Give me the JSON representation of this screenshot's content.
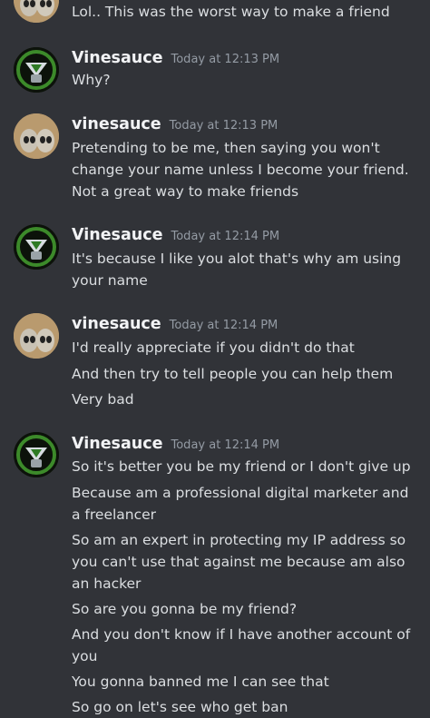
{
  "messages": [
    {
      "user": "",
      "time": "",
      "avatar": "alien-avatar",
      "lines": [
        "Lol.. This was the worst way to make a friend"
      ]
    },
    {
      "user": "Vinesauce",
      "time": "Today at 12:13 PM",
      "avatar": "vinesauce-avatar",
      "lines": [
        "Why?"
      ]
    },
    {
      "user": "vinesauce",
      "time": "Today at 12:13 PM",
      "avatar": "alien-avatar",
      "lines": [
        "Pretending to be me, then saying you won't change your name unless I become your friend. Not a great way to make friends"
      ]
    },
    {
      "user": "Vinesauce",
      "time": "Today at 12:14 PM",
      "avatar": "vinesauce-avatar",
      "lines": [
        "It's because I like you alot that's why am using your name"
      ]
    },
    {
      "user": "vinesauce",
      "time": "Today at 12:14 PM",
      "avatar": "alien-avatar",
      "lines": [
        "I'd really appreciate if you didn't do that",
        "And then try to tell people you can help them",
        "Very bad"
      ]
    },
    {
      "user": "Vinesauce",
      "time": "Today at 12:14 PM",
      "avatar": "vinesauce-avatar",
      "lines": [
        "So it's better you be my friend or I don't give up",
        "Because am a professional digital marketer and a freelancer",
        "So am an expert in protecting my IP address so you can't use that against me because am also an hacker",
        "So are you gonna be my friend?",
        "And you don't know if I have another account of you",
        "You gonna banned me I can see that",
        "So go on let's see who get ban"
      ]
    }
  ]
}
